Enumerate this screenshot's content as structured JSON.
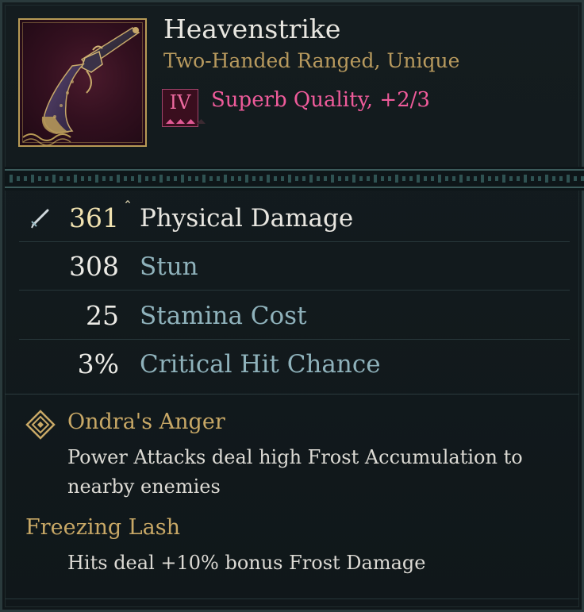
{
  "item": {
    "name": "Heavenstrike",
    "type": "Two-Handed Ranged, Unique",
    "tier_numeral": "IV",
    "tier_pips_filled": 3,
    "tier_pips_total": 4,
    "quality": "Superb Quality, +2/3",
    "icon": "flintlock-pistol-icon"
  },
  "stats": [
    {
      "value": "361",
      "label": "Physical Damage",
      "primary": true,
      "icon": "sword-icon",
      "indicator": "ˆ"
    },
    {
      "value": "308",
      "label": "Stun"
    },
    {
      "value": "25",
      "label": "Stamina Cost"
    },
    {
      "value": "3%",
      "label": "Critical Hit Chance"
    }
  ],
  "perks": [
    {
      "title": "Ondra's Anger",
      "icon": "diamond-rune-icon",
      "description": "Power Attacks deal high Frost Accumulation to nearby enemies"
    },
    {
      "title": "Freezing Lash",
      "description": "Hits deal +10% bonus Frost Damage"
    }
  ],
  "colors": {
    "primary_label": "#e8e6e0",
    "secondary_label": "#8fb2bb",
    "gold": "#c8a866",
    "quality_pink": "#ee5b9a",
    "pip_filled": "#e05a95",
    "pip_empty": "#3b2a31"
  }
}
